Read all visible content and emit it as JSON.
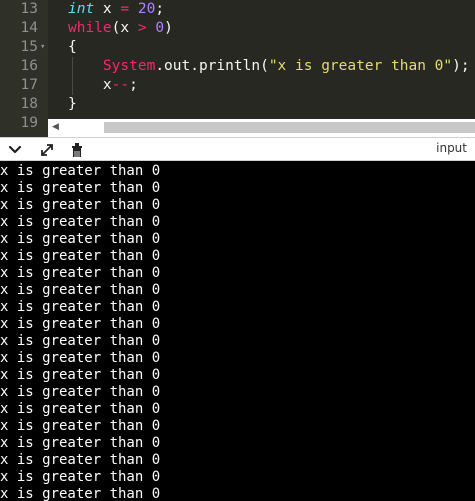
{
  "editor": {
    "lines": [
      {
        "number": "13",
        "fold": "",
        "parts": [
          {
            "t": "int",
            "c": "kwt"
          },
          {
            "t": " x ",
            "c": ""
          },
          {
            "t": "=",
            "c": "op"
          },
          {
            "t": " ",
            "c": ""
          },
          {
            "t": "20",
            "c": "num"
          },
          {
            "t": ";",
            "c": ""
          }
        ]
      },
      {
        "number": "14",
        "fold": "",
        "parts": [
          {
            "t": "while",
            "c": "kw"
          },
          {
            "t": "(x ",
            "c": ""
          },
          {
            "t": ">",
            "c": "op"
          },
          {
            "t": " ",
            "c": ""
          },
          {
            "t": "0",
            "c": "num"
          },
          {
            "t": ")",
            "c": ""
          }
        ]
      },
      {
        "number": "15",
        "fold": "▾",
        "parts": [
          {
            "t": "{",
            "c": ""
          }
        ]
      },
      {
        "number": "16",
        "fold": "",
        "parts": [
          {
            "t": "    ",
            "c": ""
          },
          {
            "t": "System",
            "c": "cls"
          },
          {
            "t": ".out.println(",
            "c": ""
          },
          {
            "t": "\"x is greater than 0\"",
            "c": "str"
          },
          {
            "t": ");",
            "c": ""
          }
        ]
      },
      {
        "number": "17",
        "fold": "",
        "parts": [
          {
            "t": "    x",
            "c": ""
          },
          {
            "t": "--",
            "c": "op"
          },
          {
            "t": ";",
            "c": ""
          }
        ]
      },
      {
        "number": "18",
        "fold": "",
        "parts": [
          {
            "t": "}",
            "c": ""
          }
        ]
      },
      {
        "number": "19",
        "fold": "",
        "parts": []
      }
    ],
    "scroll_left_icon": "caret-left-icon"
  },
  "toolbar": {
    "icons": [
      "chevron-down-icon",
      "expand-arrows-icon",
      "clear-console-icon"
    ],
    "input_label": "input"
  },
  "console": {
    "lines": [
      "x is greater than 0",
      "x is greater than 0",
      "x is greater than 0",
      "x is greater than 0",
      "x is greater than 0",
      "x is greater than 0",
      "x is greater than 0",
      "x is greater than 0",
      "x is greater than 0",
      "x is greater than 0",
      "x is greater than 0",
      "x is greater than 0",
      "x is greater than 0",
      "x is greater than 0",
      "x is greater than 0",
      "x is greater than 0",
      "x is greater than 0",
      "x is greater than 0",
      "x is greater than 0",
      "x is greater than 0"
    ]
  },
  "colors": {
    "editor_bg": "#272822",
    "keyword": "#f92672",
    "type_keyword": "#66d9ef",
    "number": "#ae81ff",
    "string": "#e6db74",
    "console_bg": "#000000",
    "console_text": "#ffffff"
  }
}
